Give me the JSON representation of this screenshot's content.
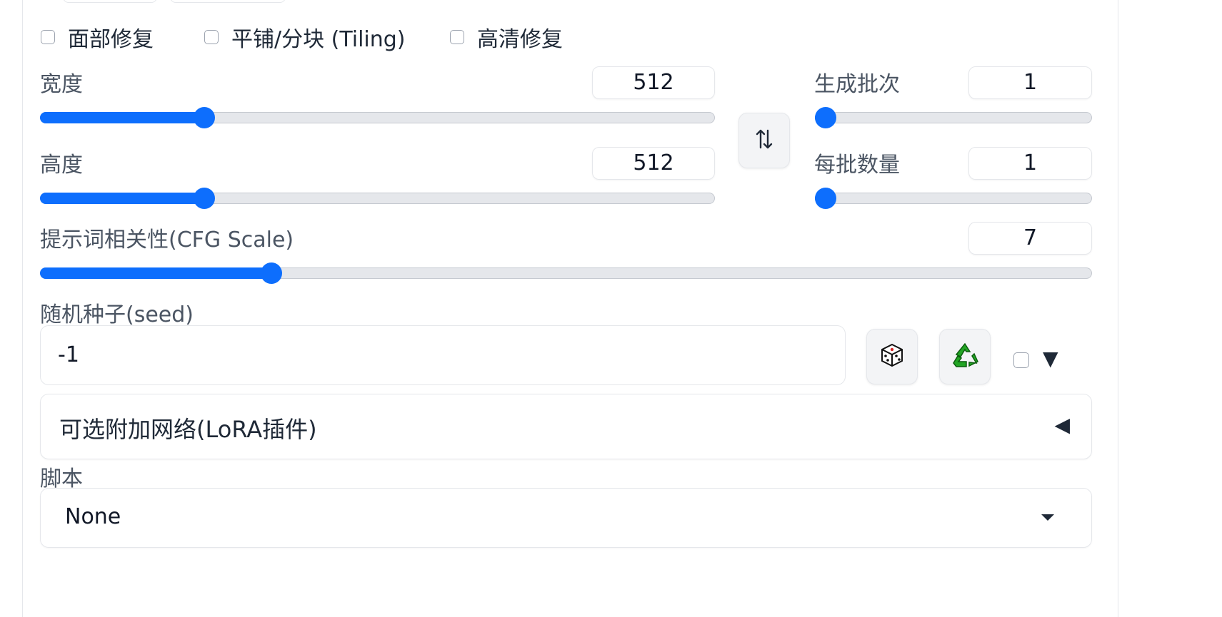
{
  "options": {
    "face_restore": {
      "label": "面部修复",
      "checked": false
    },
    "tiling": {
      "label": "平铺/分块 (Tiling)",
      "checked": false
    },
    "hires_fix": {
      "label": "高清修复",
      "checked": false
    }
  },
  "width": {
    "label": "宽度",
    "value": "512",
    "fraction": 0.235
  },
  "height": {
    "label": "高度",
    "value": "512",
    "fraction": 0.235
  },
  "batch_count": {
    "label": "生成批次",
    "value": "1",
    "fraction": 0.0
  },
  "batch_size": {
    "label": "每批数量",
    "value": "1",
    "fraction": 0.0
  },
  "cfg_scale": {
    "label": "提示词相关性(CFG Scale)",
    "value": "7",
    "fraction": 0.214
  },
  "swap_button": {
    "icon": "swap-vertical-icon",
    "glyph": "⇅"
  },
  "seed": {
    "label": "随机种子(seed)",
    "value": "-1",
    "dice_icon": "dice-icon",
    "recycle_icon": "recycle-icon",
    "extra_checked": false,
    "expand_icon": "▼"
  },
  "lora": {
    "label": "可选附加网络(LoRA插件)",
    "toggle_icon": "◀"
  },
  "script": {
    "label": "脚本",
    "value": "None"
  },
  "colors": {
    "accent": "#0d6efd",
    "track": "#e5e7eb",
    "border": "#e5e7eb"
  }
}
